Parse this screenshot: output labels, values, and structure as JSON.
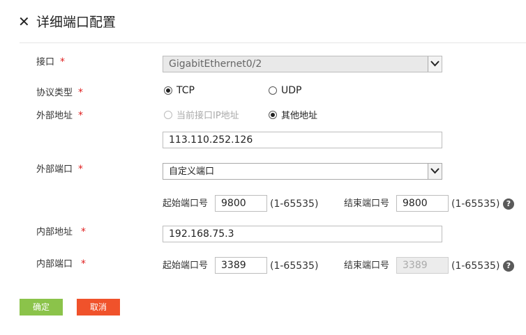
{
  "header": {
    "close_icon": "✕",
    "title": "详细端口配置"
  },
  "form": {
    "required_mark": "*",
    "interface": {
      "label": "接口",
      "value": "GigabitEthernet0/2"
    },
    "protocol": {
      "label": "协议类型",
      "options": [
        "TCP",
        "UDP"
      ],
      "selected": "TCP"
    },
    "external_address": {
      "label": "外部地址",
      "options": [
        "当前接口IP地址",
        "其他地址"
      ],
      "selected": "其他地址",
      "value": "113.110.252.126"
    },
    "external_port": {
      "label": "外部端口",
      "mode": "自定义端口",
      "start_label": "起始端口号",
      "start_value": "9800",
      "start_range": "(1-65535)",
      "end_label": "结束端口号",
      "end_value": "9800",
      "end_range": "(1-65535)"
    },
    "internal_address": {
      "label": "内部地址",
      "value": "192.168.75.3"
    },
    "internal_port": {
      "label": "内部端口",
      "start_label": "起始端口号",
      "start_value": "3389",
      "start_range": "(1-65535)",
      "end_label": "结束端口号",
      "end_value": "3389",
      "end_range": "(1-65535)"
    },
    "help_icon": "?"
  },
  "buttons": {
    "ok": "确定",
    "cancel": "取消"
  },
  "colors": {
    "ok": "#8bc34a",
    "cancel": "#f0522b",
    "required": "#e02020"
  }
}
